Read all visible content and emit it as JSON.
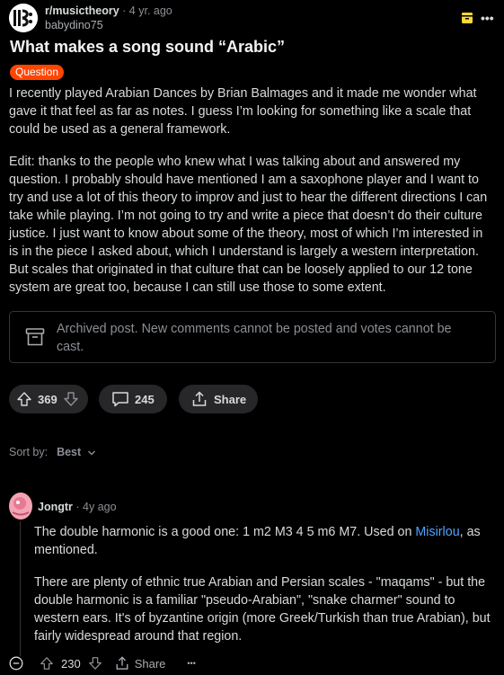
{
  "post": {
    "subreddit": "r/musictheory",
    "age": "4 yr. ago",
    "author": "babydino75",
    "title": "What makes a song sound “Arabic”",
    "flair": "Question",
    "body_1": "I recently played Arabian Dances by Brian Balmages and it made me wonder what gave it that feel as far as notes. I guess I’m looking for something like a scale that could be used as a general framework.",
    "body_2": "Edit: thanks to the people who knew what I was talking about and answered my question. I probably should have mentioned I am a saxophone player and I want to try and use a lot of this theory to improv and just to hear the different directions I can take while playing. I’m not going to try and write a piece that doesn’t do their culture justice. I just want to know about some of the theory, most of which I’m interested in is in the piece I asked about, which I understand is largely a western interpretation. But scales that originated in that culture that can be loosely applied to our 12 tone system are great too, because I can still use those to some extent.",
    "archived_notice": "Archived post. New comments cannot be posted and votes cannot be cast.",
    "votes": "369",
    "comments": "245",
    "share_label": "Share"
  },
  "sort": {
    "label": "Sort by:",
    "value": "Best"
  },
  "comment": {
    "author": "Jongtr",
    "age": "4y ago",
    "line_1_before": "The double harmonic is a good one: 1 m2 M3 4 5 m6 M7. Used on ",
    "line_1_link": "Misirlou",
    "line_1_after": ", as mentioned.",
    "body_2": "There are plenty of ethnic true Arabian and Persian scales - \"maqams\" - but the double harmonic is a familiar \"pseudo-Arabian\", \"snake charmer\" sound to western ears. It's of byzantine origin (more Greek/Turkish than true Arabian), but fairly widespread around that region.",
    "votes": "230",
    "share_label": "Share",
    "more": "•••"
  },
  "colors": {
    "background": "#000000",
    "flair": "#ff4500",
    "link": "#4fa3ff",
    "archive_badge": "#ffd635"
  },
  "icons": [
    "music-clef-avatar-icon",
    "archive-icon",
    "more-icon",
    "upvote-icon",
    "downvote-icon",
    "comment-icon",
    "share-icon",
    "chevron-down-icon",
    "collapse-icon"
  ]
}
